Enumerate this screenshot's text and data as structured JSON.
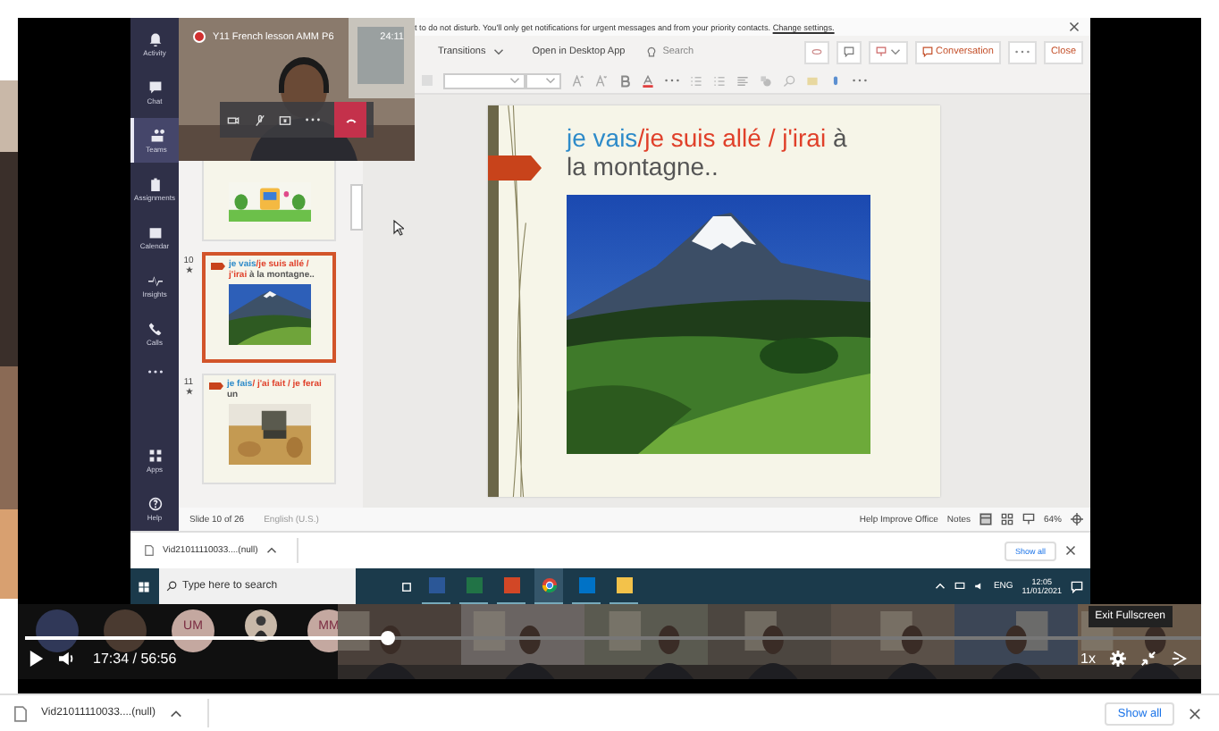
{
  "notification": {
    "text": "t to do not disturb. You'll only get notifications for urgent messages and from your priority contacts.",
    "link": "Change settings."
  },
  "teams_nav": [
    {
      "label": "Activity",
      "selected": false
    },
    {
      "label": "Chat",
      "selected": false
    },
    {
      "label": "Teams",
      "selected": true
    },
    {
      "label": "Assignments",
      "selected": false
    },
    {
      "label": "Calendar",
      "selected": false
    },
    {
      "label": "Insights",
      "selected": false
    },
    {
      "label": "Calls",
      "selected": false
    },
    {
      "label": "Apps",
      "selected": false
    },
    {
      "label": "Help",
      "selected": false
    }
  ],
  "meeting": {
    "title": "Y11 French lesson AMM P6",
    "duration": "24:11"
  },
  "ribbon": {
    "tab": "Transitions",
    "open_desktop": "Open in Desktop App",
    "search": "Search",
    "conversation": "Conversation",
    "close": "Close"
  },
  "slides": [
    {
      "kind": "banner",
      "selected": false
    },
    {
      "number": "10",
      "kind": "mountain",
      "selected": true,
      "title": [
        {
          "text": "je vais",
          "color": "#2e8bc9"
        },
        {
          "text": "/je suis allé / j'irai",
          "color": "#e0402a"
        },
        {
          "text": " à la montagne..",
          "color": "#555555"
        }
      ]
    },
    {
      "number": "11",
      "kind": "safari",
      "selected": false,
      "title": [
        {
          "text": "je fais",
          "color": "#2e8bc9"
        },
        {
          "text": "/ j'ai fait / je ferai",
          "color": "#e0402a"
        },
        {
          "text": " un",
          "color": "#555555"
        }
      ]
    }
  ],
  "current_slide": {
    "title": [
      {
        "text": "je vais",
        "color": "#2e8bc9"
      },
      {
        "text": "/je suis allé / j'irai",
        "color": "#e0402a"
      },
      {
        "text": " à la montagne..",
        "color": "#555555"
      }
    ]
  },
  "status_bar": {
    "slide": "Slide 10 of 26",
    "language": "English (U.S.)",
    "help": "Help Improve Office",
    "notes": "Notes",
    "zoom": "64%"
  },
  "inner_download": {
    "file": "Vid21011110033....(null)",
    "show_all": "Show all"
  },
  "taskbar": {
    "search_placeholder": "Type here to search",
    "language": "ENG",
    "time": "12:05",
    "date": "11/01/2021"
  },
  "participants": [
    {
      "kind": "plain"
    },
    {
      "kind": "plain"
    },
    {
      "kind": "initials",
      "initials": "UM"
    },
    {
      "kind": "picture"
    },
    {
      "kind": "initials",
      "initials": "MM"
    }
  ],
  "player": {
    "level": 0.309,
    "time": "17:34 / 56:56",
    "speed": "1x",
    "tooltip": "Exit Fullscreen"
  },
  "download_bar": {
    "file": "Vid21011110033....(null)",
    "show_all": "Show all"
  }
}
